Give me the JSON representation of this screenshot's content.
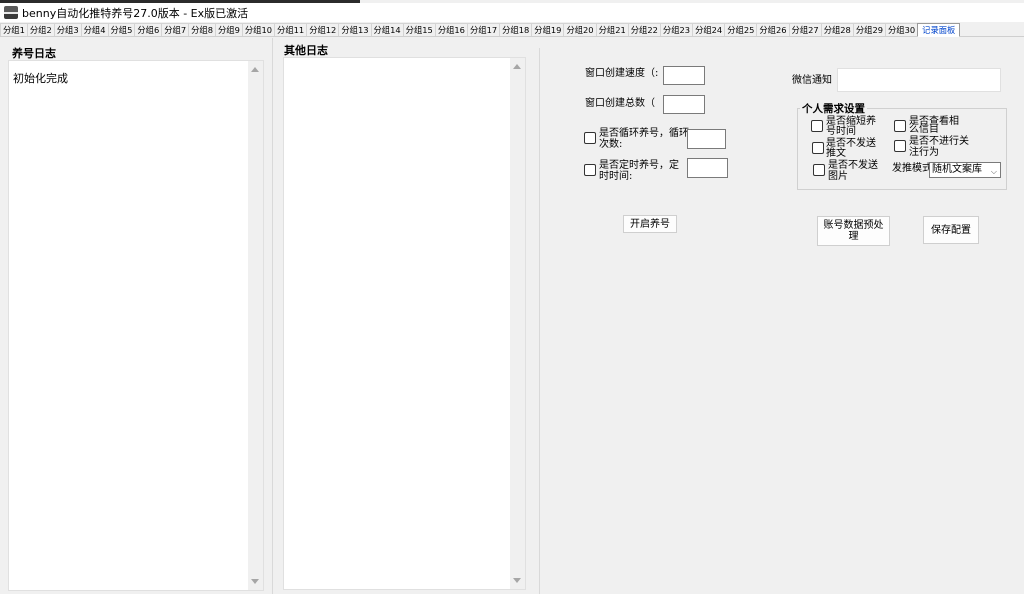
{
  "window": {
    "title": "benny自动化推特养号27.0版本 - Ex版已激活"
  },
  "tabs": [
    "分组1",
    "分组2",
    "分组3",
    "分组4",
    "分组5",
    "分组6",
    "分组7",
    "分组8",
    "分组9",
    "分组10",
    "分组11",
    "分组12",
    "分组13",
    "分组14",
    "分组15",
    "分组16",
    "分组17",
    "分组18",
    "分组19",
    "分组20",
    "分组21",
    "分组22",
    "分组23",
    "分组24",
    "分组25",
    "分组26",
    "分组27",
    "分组28",
    "分组29",
    "分组30",
    "记录面板"
  ],
  "active_tab": "记录面板",
  "left_log": {
    "title": "养号日志",
    "content": "初始化完成"
  },
  "other_log": {
    "title": "其他日志",
    "content": ""
  },
  "settings": {
    "window_speed_label": "窗口创建速度（:",
    "window_speed_value": "",
    "window_total_label": "窗口创建总数（",
    "window_total_value": "",
    "loop_label_line1": "是否循环养号，循环",
    "loop_label_line2": "次数:",
    "loop_checked": false,
    "loop_value": "",
    "timed_label_line1": "是否定时养号，定",
    "timed_label_line2": "时时间:",
    "timed_checked": false,
    "timed_value": "",
    "start_button": "开启养号",
    "wechat_label": "微信通知",
    "wechat_value": ""
  },
  "personal": {
    "group_title": "个人需求设置",
    "options": [
      {
        "line1": "是否缩短养",
        "line2": "号时间",
        "checked": false
      },
      {
        "line1": "是否查看相",
        "line2": "么信目",
        "checked": false
      },
      {
        "line1": "是否不发送",
        "line2": "推文",
        "checked": false
      },
      {
        "line1": "是否不进行关",
        "line2": "注行为",
        "checked": false
      },
      {
        "line1": "是否不发送",
        "line2": "图片",
        "checked": false
      }
    ],
    "mode_label": "发推模式",
    "mode_value": "随机文案库"
  },
  "buttons": {
    "preprocess": "账号数据预处理",
    "save_config": "保存配置"
  },
  "colors": {
    "active_tab_text": "#0044cc",
    "window_bg": "#f0f0f0"
  }
}
